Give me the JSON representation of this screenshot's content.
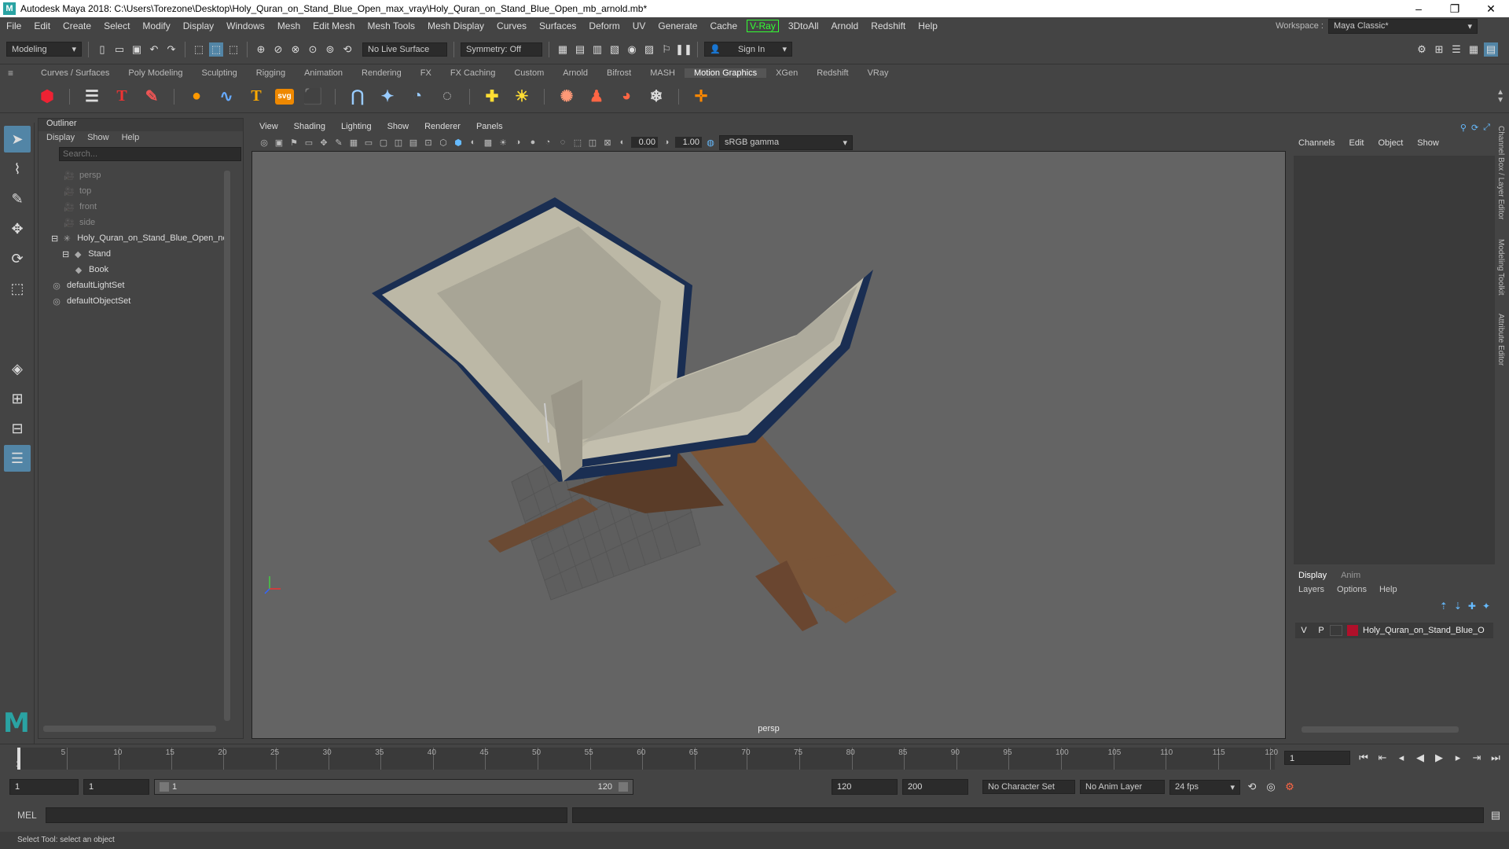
{
  "titlebar": {
    "title": "Autodesk Maya 2018: C:\\Users\\Torezone\\Desktop\\Holy_Quran_on_Stand_Blue_Open_max_vray\\Holy_Quran_on_Stand_Blue_Open_mb_arnold.mb*"
  },
  "menubar": {
    "items": [
      "File",
      "Edit",
      "Create",
      "Select",
      "Modify",
      "Display",
      "Windows",
      "Mesh",
      "Edit Mesh",
      "Mesh Tools",
      "Mesh Display",
      "Curves",
      "Surfaces",
      "Deform",
      "UV",
      "Generate",
      "Cache"
    ],
    "vray": "V-Ray",
    "items2": [
      "3DtoAll",
      "Arnold",
      "Redshift",
      "Help"
    ],
    "workspace_label": "Workspace :",
    "workspace_value": "Maya Classic*"
  },
  "statusline": {
    "mode": "Modeling",
    "live_surface": "No Live Surface",
    "symmetry": "Symmetry: Off",
    "sign_in": "Sign In"
  },
  "shelf": {
    "tabs": [
      "Curves / Surfaces",
      "Poly Modeling",
      "Sculpting",
      "Rigging",
      "Animation",
      "Rendering",
      "FX",
      "FX Caching",
      "Custom",
      "Arnold",
      "Bifrost",
      "MASH",
      "Motion Graphics",
      "XGen",
      "Redshift",
      "VRay"
    ],
    "active_tab": "Motion Graphics",
    "svg_label": "svg"
  },
  "outliner": {
    "title": "Outliner",
    "menu": [
      "Display",
      "Show",
      "Help"
    ],
    "search_placeholder": "Search...",
    "rows": [
      {
        "label": "persp",
        "dim": true,
        "indent": 0,
        "icon": "camera-icon"
      },
      {
        "label": "top",
        "dim": true,
        "indent": 0,
        "icon": "camera-icon"
      },
      {
        "label": "front",
        "dim": true,
        "indent": 0,
        "icon": "camera-icon"
      },
      {
        "label": "side",
        "dim": true,
        "indent": 0,
        "icon": "camera-icon"
      },
      {
        "label": "Holy_Quran_on_Stand_Blue_Open_nc",
        "dim": false,
        "indent": 0,
        "icon": "group-icon"
      },
      {
        "label": "Stand",
        "dim": false,
        "indent": 1,
        "icon": "mesh-icon"
      },
      {
        "label": "Book",
        "dim": false,
        "indent": 2,
        "icon": "mesh-icon"
      },
      {
        "label": "defaultLightSet",
        "dim": false,
        "indent": 0,
        "icon": "set-icon"
      },
      {
        "label": "defaultObjectSet",
        "dim": false,
        "indent": 0,
        "icon": "set-icon"
      }
    ]
  },
  "viewport": {
    "menu": [
      "View",
      "Shading",
      "Lighting",
      "Show",
      "Renderer",
      "Panels"
    ],
    "exposure": "0.00",
    "gamma": "1.00",
    "color_space": "sRGB gamma",
    "camera": "persp"
  },
  "channelbox": {
    "menu": [
      "Channels",
      "Edit",
      "Object",
      "Show"
    ],
    "layer_tabs": [
      "Display",
      "Anim"
    ],
    "layer_menu": [
      "Layers",
      "Options",
      "Help"
    ],
    "layer": {
      "v": "V",
      "p": "P",
      "name": "Holy_Quran_on_Stand_Blue_O",
      "color": "#b0102a"
    }
  },
  "sidetabs": [
    "Channel Box / Layer Editor",
    "Modeling Toolkit",
    "Attribute Editor"
  ],
  "timeline": {
    "ticks": [
      "5",
      "10",
      "15",
      "20",
      "25",
      "30",
      "35",
      "40",
      "45",
      "50",
      "55",
      "60",
      "65",
      "70",
      "75",
      "80",
      "85",
      "90",
      "95",
      "100",
      "105",
      "110",
      "115",
      "120"
    ],
    "current_frame_marker": "1",
    "current_frame": "1"
  },
  "range": {
    "start": "1",
    "playback_start": "1",
    "slider_start": "1",
    "slider_end": "120",
    "playback_end": "120",
    "end": "200",
    "character_set": "No Character Set",
    "anim_layer": "No Anim Layer",
    "fps": "24 fps"
  },
  "cmdline": {
    "label": "MEL"
  },
  "helpline": {
    "text": "Select Tool: select an object"
  }
}
